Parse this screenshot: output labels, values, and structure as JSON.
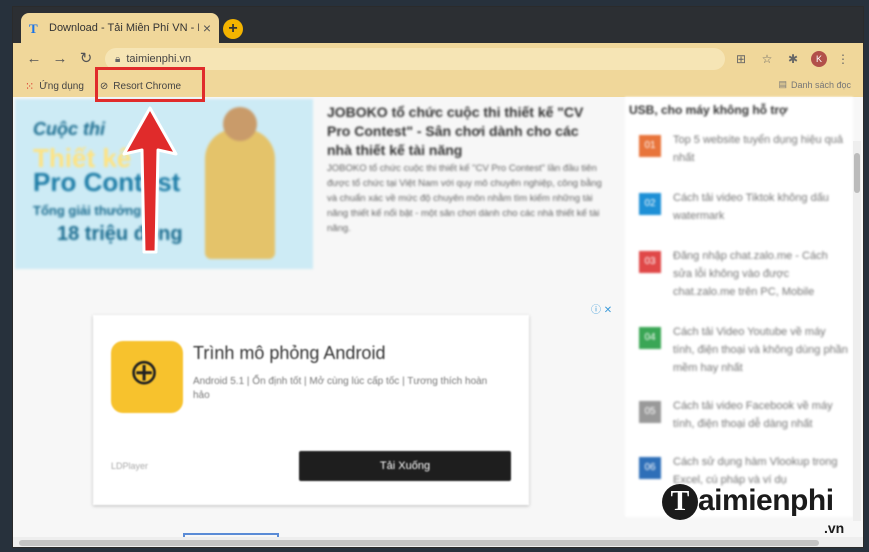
{
  "browser": {
    "tab_title": "Download - Tải Miễn Phí VN - Ph",
    "tab_favicon": "T",
    "tab_close": "×",
    "new_tab": "+",
    "url": "taimienphi.vn",
    "profile_initial": "K"
  },
  "bookmarks": {
    "apps_label": "Ứng dụng",
    "item_label": "Resort Chrome",
    "reading_list": "Danh sách đọc"
  },
  "page": {
    "banner": {
      "line1": "Cuộc thi",
      "line2": "Thiết kế",
      "line3": "Pro Contest",
      "line4": "Tổng giải thưởng",
      "line5": "18 triệu đồng"
    },
    "article_title": "JOBOKO tổ chức cuộc thi thiết kế \"CV Pro Contest\" - Sân chơi dành cho các nhà thiết kế tài năng",
    "article_body": "JOBOKO tổ chức cuộc thi thiết kế \"CV Pro Contest\" lần đầu tiên được tổ chức tại Việt Nam với quy mô chuyên nghiệp, công bằng và chuẩn xác về mức độ chuyên môn nhằm tìm kiếm những tài năng thiết kế nổi bật - một sân chơi dành cho các nhà thiết kế tài năng.",
    "ad": {
      "title": "Trình mô phỏng Android",
      "subtitle": "Android 5.1 | Ổn định tốt | Mở cùng lúc cấp tốc | Tương thích hoàn hảo",
      "brand": "LDPlayer",
      "button": "Tải Xuống",
      "choice": "ⓘ ✕"
    },
    "sidebar": {
      "heading": "USB, cho máy không hỗ trợ",
      "items": [
        {
          "num": "01",
          "color": "#e8743b",
          "text": "Top 5 website tuyển dụng hiệu quả nhất"
        },
        {
          "num": "02",
          "color": "#1e90d6",
          "text": "Cách tải video Tiktok không dấu watermark"
        },
        {
          "num": "03",
          "color": "#e04848",
          "text": "Đăng nhập chat.zalo.me - Cách sửa lỗi không vào được chat.zalo.me trên PC, Mobile"
        },
        {
          "num": "04",
          "color": "#3aa655",
          "text": "Cách tải Video Youtube về máy tính, điện thoại và không dùng phần mềm hay nhất"
        },
        {
          "num": "05",
          "color": "#999999",
          "text": "Cách tải video Facebook về máy tính, điện thoại dễ dàng nhất"
        },
        {
          "num": "06",
          "color": "#2e6fb8",
          "text": "Cách sử dụng hàm Vlookup trong Excel, cú pháp và ví dụ"
        }
      ]
    }
  },
  "watermark": {
    "logo_letter": "T",
    "text": "aimienphi",
    "tld": ".vn"
  },
  "colors": {
    "highlight": "#e02b2b",
    "arrow": "#e02b2b"
  }
}
